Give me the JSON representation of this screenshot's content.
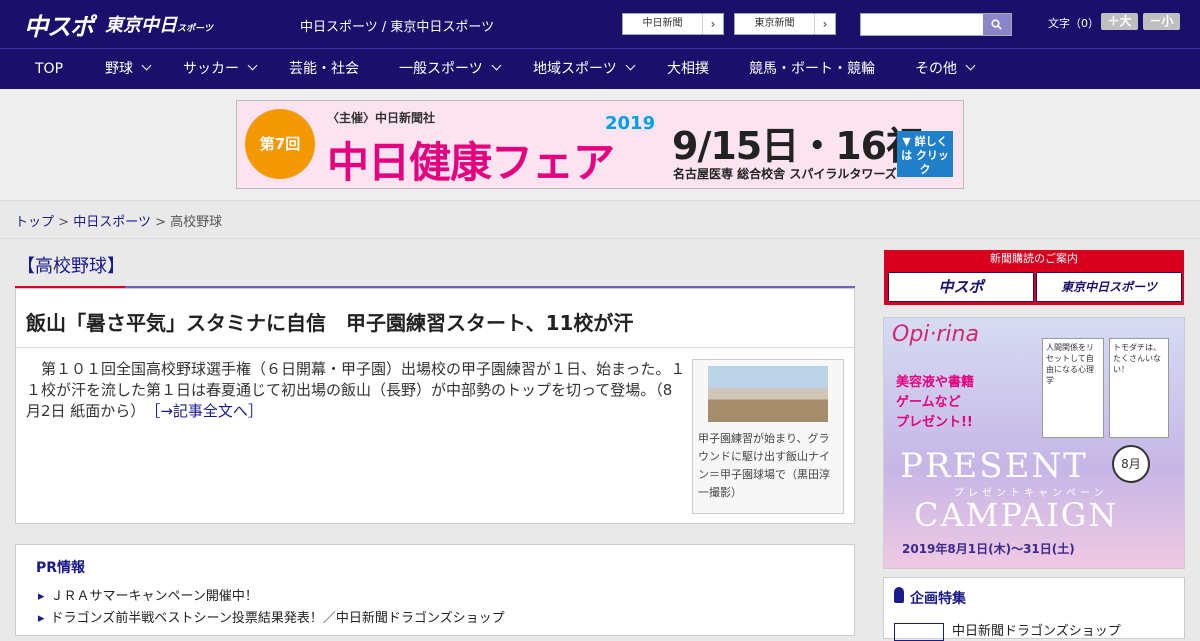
{
  "header": {
    "logo_main": "中スポ",
    "logo_tokyo": "東京中日",
    "logo_tokyo_sub": "スポーツ",
    "site_title": "中日スポーツ / 東京中日スポーツ",
    "btn_chunichi": "中日新聞",
    "btn_tokyo": "東京新聞",
    "search_placeholder": "",
    "font_size_label": "文字（0）",
    "font_plus": "＋大",
    "font_minus": "－小"
  },
  "nav": [
    {
      "label": "TOP",
      "dropdown": false
    },
    {
      "label": "野球",
      "dropdown": true
    },
    {
      "label": "サッカー",
      "dropdown": true
    },
    {
      "label": "芸能・社会",
      "dropdown": false
    },
    {
      "label": "一般スポーツ",
      "dropdown": true
    },
    {
      "label": "地域スポーツ",
      "dropdown": true
    },
    {
      "label": "大相撲",
      "dropdown": false
    },
    {
      "label": "競馬・ボート・競輪",
      "dropdown": false
    },
    {
      "label": "その他",
      "dropdown": true
    }
  ],
  "banner": {
    "badge": "第7回",
    "sponsor": "〈主催〉中日新聞社",
    "title_a": "中日",
    "title_b": "健康フェア",
    "year": "2019",
    "dates": "9/15日・16祝",
    "venue": "名古屋医専 総合校舎 スパイラルタワーズ",
    "detail": "▼ 詳しくは クリック"
  },
  "breadcrumb": {
    "top": "トップ",
    "sep": ">",
    "chunichi": "中日スポーツ",
    "current": "高校野球"
  },
  "section": {
    "title": "【高校野球】"
  },
  "article": {
    "headline": "飯山「暑さ平気」スタミナに自信　甲子園練習スタート、11校が汗",
    "lead": "　第１０１回全国高校野球選手権（６日開幕・甲子園）出場校の甲子園練習が１日、始まった。１１校が汗を流した第１日は春夏通じて初出場の飯山（長野）が中部勢のトップを切って登場。（8月2日 紙面から）",
    "more_link": "［→記事全文へ］",
    "photo_caption": "甲子園練習が始まり、グラウンドに駆け出す飯山ナイン＝甲子園球場で（黒田淳一撮影）"
  },
  "pr": {
    "title": "PR情報",
    "items": [
      "ＪＲＡサマーキャンペーン開催中！",
      "ドラゴンズ前半戦ベストシーン投票結果発表！／中日新聞ドラゴンズショップ"
    ]
  },
  "sidebar": {
    "subscribe_header": "新聞購読のご案内",
    "subscribe_chuspo": "中スポ",
    "subscribe_tokyo": "東京中日スポーツ",
    "ad": {
      "brand": "Opi·rina",
      "copy": "美容液や書籍\nゲームなど\nプレゼント!!",
      "book1": "人間関係をリセットして自由になる心理学",
      "book2": "トモダチは、たくさんいない！",
      "present": "PRESENT",
      "kana": "プレゼントキャンペーン",
      "campaign": "CAMPAIGN",
      "month": "8月",
      "period": "2019年8月1日(木)〜31日(土)"
    },
    "kikaku_title": "企画特集",
    "kikaku_item": "中日新聞ドラゴンズショップ"
  },
  "colors": {
    "brand_navy": "#1a0f6b",
    "accent_red": "#d4002a",
    "link": "#1a1a8a"
  }
}
